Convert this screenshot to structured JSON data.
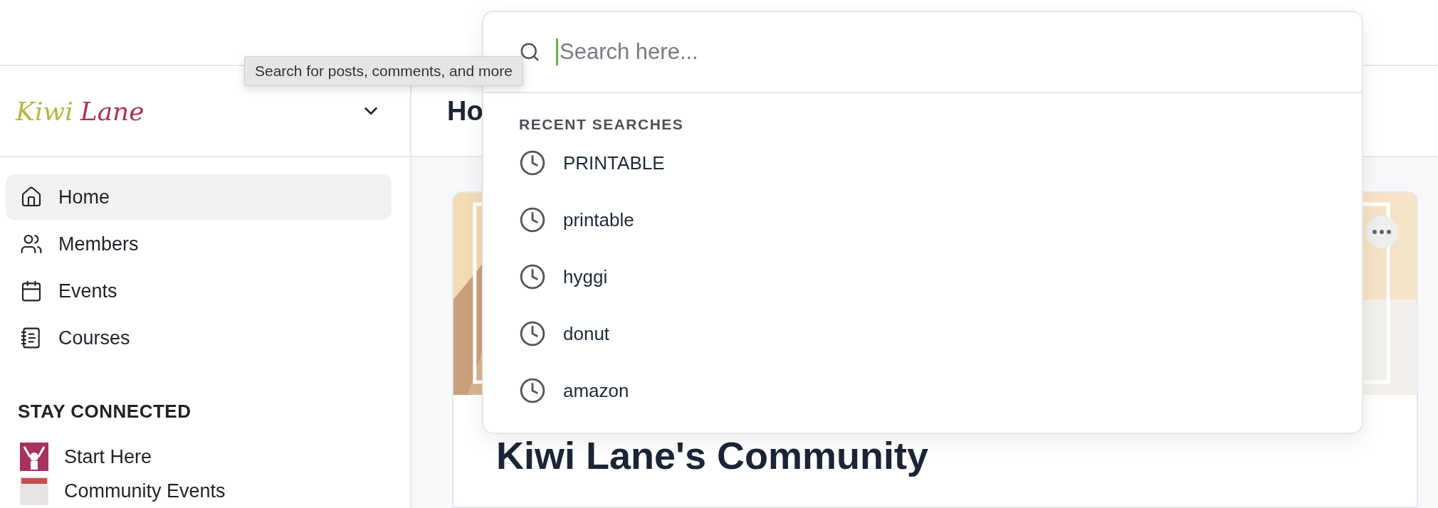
{
  "brand": {
    "word_1": "Kiwi",
    "word_2": "Lane"
  },
  "sidebar": {
    "items": [
      {
        "label": "Home",
        "selected": true
      },
      {
        "label": "Members",
        "selected": false
      },
      {
        "label": "Events",
        "selected": false
      },
      {
        "label": "Courses",
        "selected": false
      }
    ],
    "section_title": "STAY CONNECTED",
    "spaces": [
      {
        "label": "Start Here",
        "color": "#a8325e"
      },
      {
        "label": "Community Events",
        "color": "#e8e4e4"
      }
    ]
  },
  "page": {
    "title": "Ho",
    "card": {
      "title": "Kiwi Lane's Community"
    }
  },
  "tooltip": "Search for posts, comments, and more",
  "search": {
    "placeholder": "Search here...",
    "recent_title": "RECENT SEARCHES",
    "recent": [
      "PRINTABLE",
      "printable",
      "hyggi",
      "donut",
      "amazon"
    ]
  }
}
